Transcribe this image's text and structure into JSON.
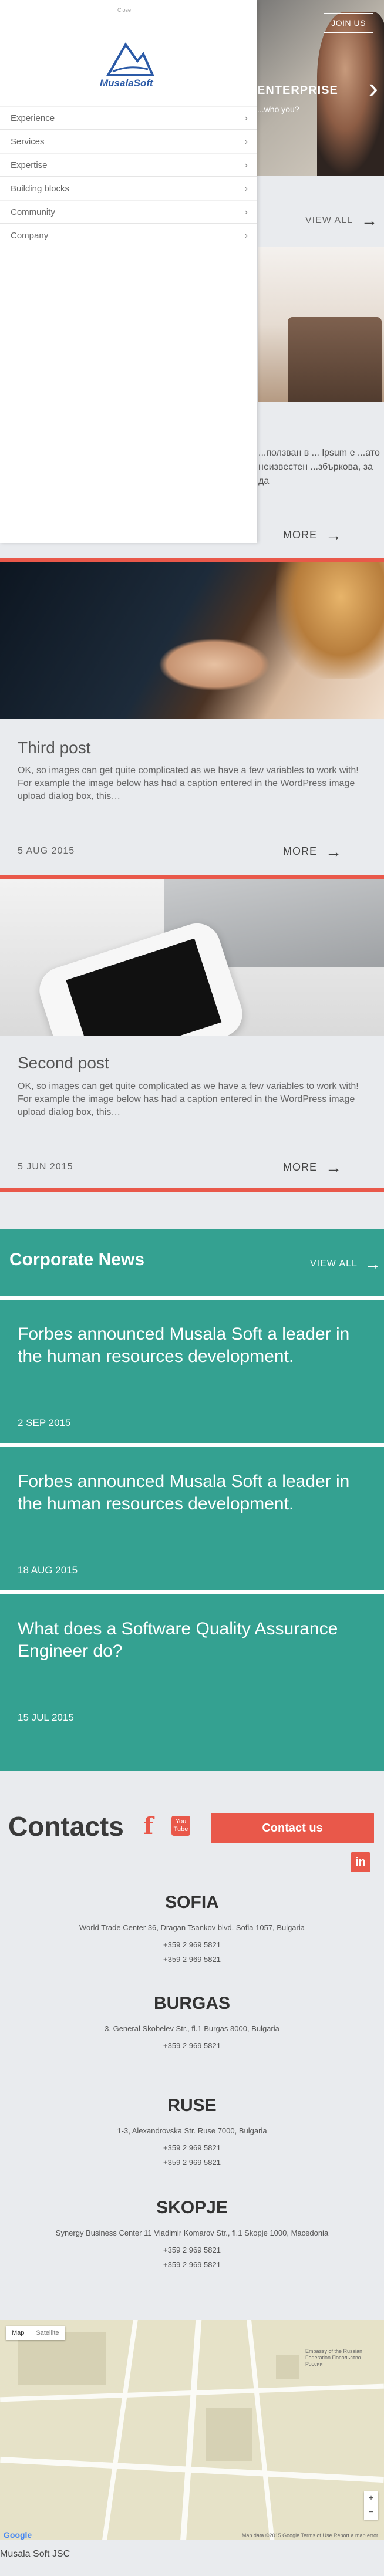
{
  "hero": {
    "join_label": "JOIN US",
    "title": "ENTERPRISE",
    "subtitle": "...who you?",
    "arrow": "›"
  },
  "top_viewall": {
    "label": "VIEW ALL",
    "arrow": "→"
  },
  "post1": {
    "text": "...ползван в ... lpsum е ...ато неизвестен ...збъркова, за да",
    "more_label": "MORE",
    "arrow": "→"
  },
  "posts": [
    {
      "title": "Third post",
      "body": "OK, so images can get quite complicated as we have a few variables to work with! For example the image below has had a caption entered in the WordPress image upload dialog box, this…",
      "date": "5 AUG 2015",
      "more_label": "MORE",
      "arrow": "→"
    },
    {
      "title": "Second post",
      "body": "OK, so images can get quite complicated as we have a few variables to work with! For example the image below has had a caption entered in the WordPress image upload dialog box, this…",
      "date": "5 JUN 2015",
      "more_label": "MORE",
      "arrow": "→"
    }
  ],
  "news": {
    "heading": "Corporate News",
    "viewall_label": "VIEW ALL",
    "arrow": "→",
    "items": [
      {
        "title": "Forbes announced Musala Soft a leader in the human resources development.",
        "date": "2 SEP 2015"
      },
      {
        "title": "Forbes announced Musala Soft a leader in the human resources development.",
        "date": "18 AUG 2015"
      },
      {
        "title": "What does a Software Quality Assurance Engineer do?",
        "date": "15 JUL 2015"
      }
    ]
  },
  "contacts": {
    "title": "Contacts",
    "button_label": "Contact us",
    "fb_glyph": "f",
    "yt_label": "You Tube",
    "li_glyph": "in",
    "offices": [
      {
        "city": "SOFIA",
        "address": "World Trade Center 36, Dragan Tsankov blvd. Sofia 1057, Bulgaria",
        "phones": [
          "+359 2 969 5821",
          "+359 2 969 5821"
        ]
      },
      {
        "city": "BURGAS",
        "address": "3, General Skobelev Str., fl.1 Burgas 8000, Bulgaria",
        "phones": [
          "+359 2 969 5821"
        ]
      },
      {
        "city": "RUSE",
        "address": "1-3, Alexandrovska Str. Ruse 7000, Bulgaria",
        "phones": [
          "+359 2 969 5821",
          "+359 2 969 5821"
        ]
      },
      {
        "city": "SKOPJE",
        "address": "Synergy Business Center 11 Vladimir Komarov Str., fl.1 Skopje 1000, Macedonia",
        "phones": [
          "+359 2 969 5821",
          "+359 2 969 5821"
        ]
      }
    ]
  },
  "map": {
    "tab_map": "Map",
    "tab_satellite": "Satellite",
    "embassy_label": "Embassy of the Russian Federation Посольство России",
    "google_label": "Google",
    "footer_info": "Map data ©2015 Google   Terms of Use   Report a map error",
    "zoom_in": "+",
    "zoom_out": "−"
  },
  "footer": {
    "copyright": "Musala Soft JSC"
  },
  "drawer": {
    "close_label": "Close",
    "logo_text": "MusalaSoft",
    "menu": [
      {
        "label": "Experience",
        "chevron": "›"
      },
      {
        "label": "Services",
        "chevron": "›"
      },
      {
        "label": "Expertise",
        "chevron": "›"
      },
      {
        "label": "Building blocks",
        "chevron": "›"
      },
      {
        "label": "Community",
        "chevron": "›"
      },
      {
        "label": "Company",
        "chevron": "›"
      }
    ]
  },
  "colors": {
    "accent": "#e9584a",
    "teal": "#34a191",
    "brand_blue": "#2b5aa7"
  }
}
